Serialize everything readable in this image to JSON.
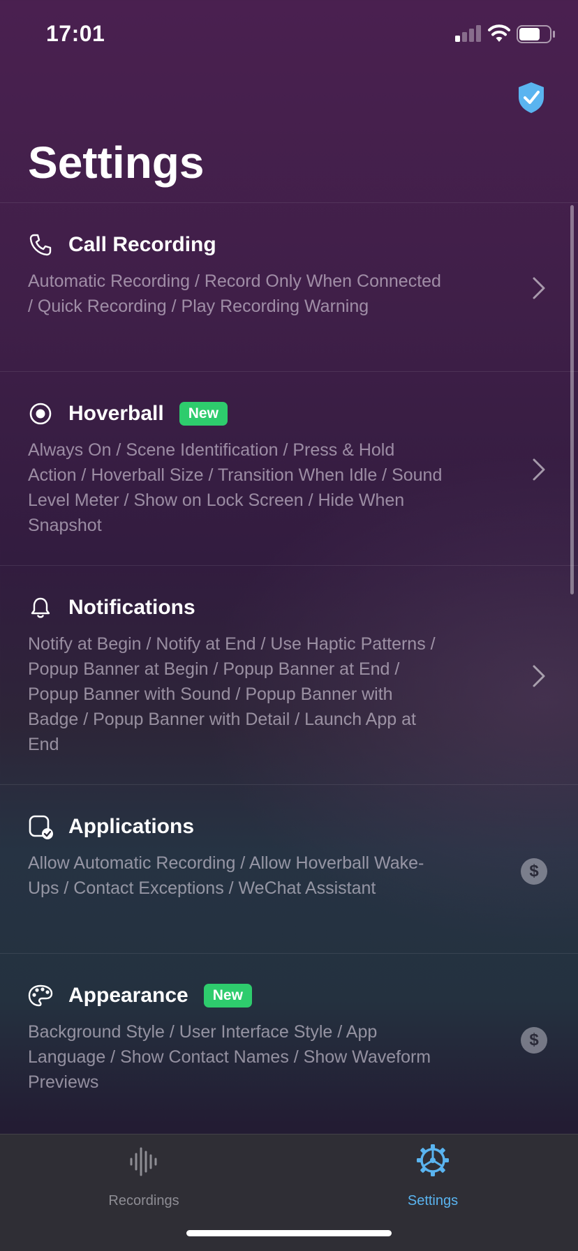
{
  "status_bar": {
    "time": "17:01",
    "signal_bars_active": 1,
    "signal_bars_total": 4,
    "battery_level": 0.7
  },
  "header": {
    "title": "Settings",
    "shield_icon": "shield-check-icon"
  },
  "settings": [
    {
      "icon": "phone-icon",
      "title": "Call Recording",
      "badge": "",
      "description": "Automatic Recording / Record Only When Connected / Quick Recording / Play Recording Warning",
      "accessory": "chevron"
    },
    {
      "icon": "hoverball-icon",
      "title": "Hoverball",
      "badge": "New",
      "description": "Always On / Scene Identification / Press & Hold Action / Hoverball Size / Transition When Idle / Sound Level Meter / Show on Lock Screen / Hide When Snapshot",
      "accessory": "chevron"
    },
    {
      "icon": "bell-icon",
      "title": "Notifications",
      "badge": "",
      "description": "Notify at Begin / Notify at End / Use Haptic Patterns / Popup Banner at Begin / Popup Banner at End / Popup Banner with Sound / Popup Banner with Badge / Popup Banner with Detail / Launch App at End",
      "accessory": "chevron"
    },
    {
      "icon": "app-check-icon",
      "title": "Applications",
      "badge": "",
      "description": "Allow Automatic Recording / Allow Hoverball Wake-Ups / Contact Exceptions / WeChat Assistant",
      "accessory": "$"
    },
    {
      "icon": "palette-icon",
      "title": "Appearance",
      "badge": "New",
      "description": "Background Style / User Interface Style / App Language / Show Contact Names / Show Waveform Previews",
      "accessory": "$"
    }
  ],
  "tab_bar": {
    "tabs": [
      {
        "label": "Recordings",
        "icon": "waveform-icon",
        "active": false
      },
      {
        "label": "Settings",
        "icon": "gear-icon",
        "active": true
      }
    ],
    "active_color": "#5ab4f0",
    "inactive_color": "#8e8d94"
  },
  "colors": {
    "badge_green": "#2ecc6d",
    "shield_blue": "#5ab4f0"
  }
}
